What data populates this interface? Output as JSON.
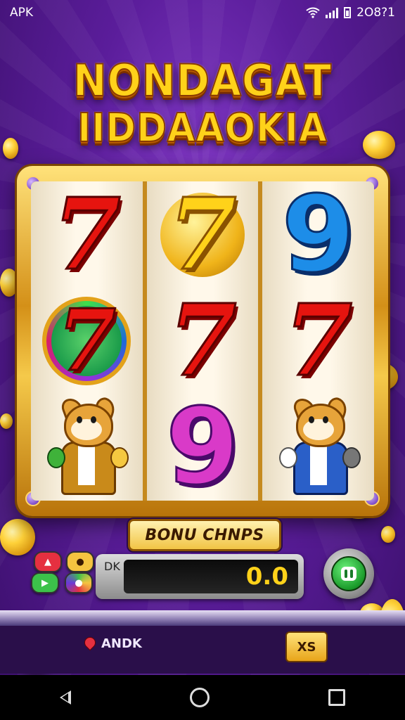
{
  "status_bar": {
    "left_label": "APK",
    "time": "2O8?1"
  },
  "game": {
    "title_line1": "NONDAGAT",
    "title_line2": "IIDDAAOKIA",
    "reels": [
      [
        "red-seven",
        "red-seven-rainbow-ring",
        "cat-gold-suit"
      ],
      [
        "gold-seven",
        "red-seven",
        "purple-nine"
      ],
      [
        "blue-nine",
        "red-seven",
        "cat-blue-suit"
      ]
    ],
    "symbol_glyphs": {
      "seven": "7",
      "nine": "9"
    },
    "bonus_label": "BONU CHNPS",
    "display_label": "DK",
    "credit_value": "0.0",
    "spin_icon": "spin-button-icon"
  },
  "bottom_bar": {
    "andk_label": "ANDK",
    "xs_label": "XS"
  },
  "colors": {
    "bg_purple": "#5b1d9b",
    "gold": "#ffd21a",
    "seven_red": "#e6140f"
  }
}
